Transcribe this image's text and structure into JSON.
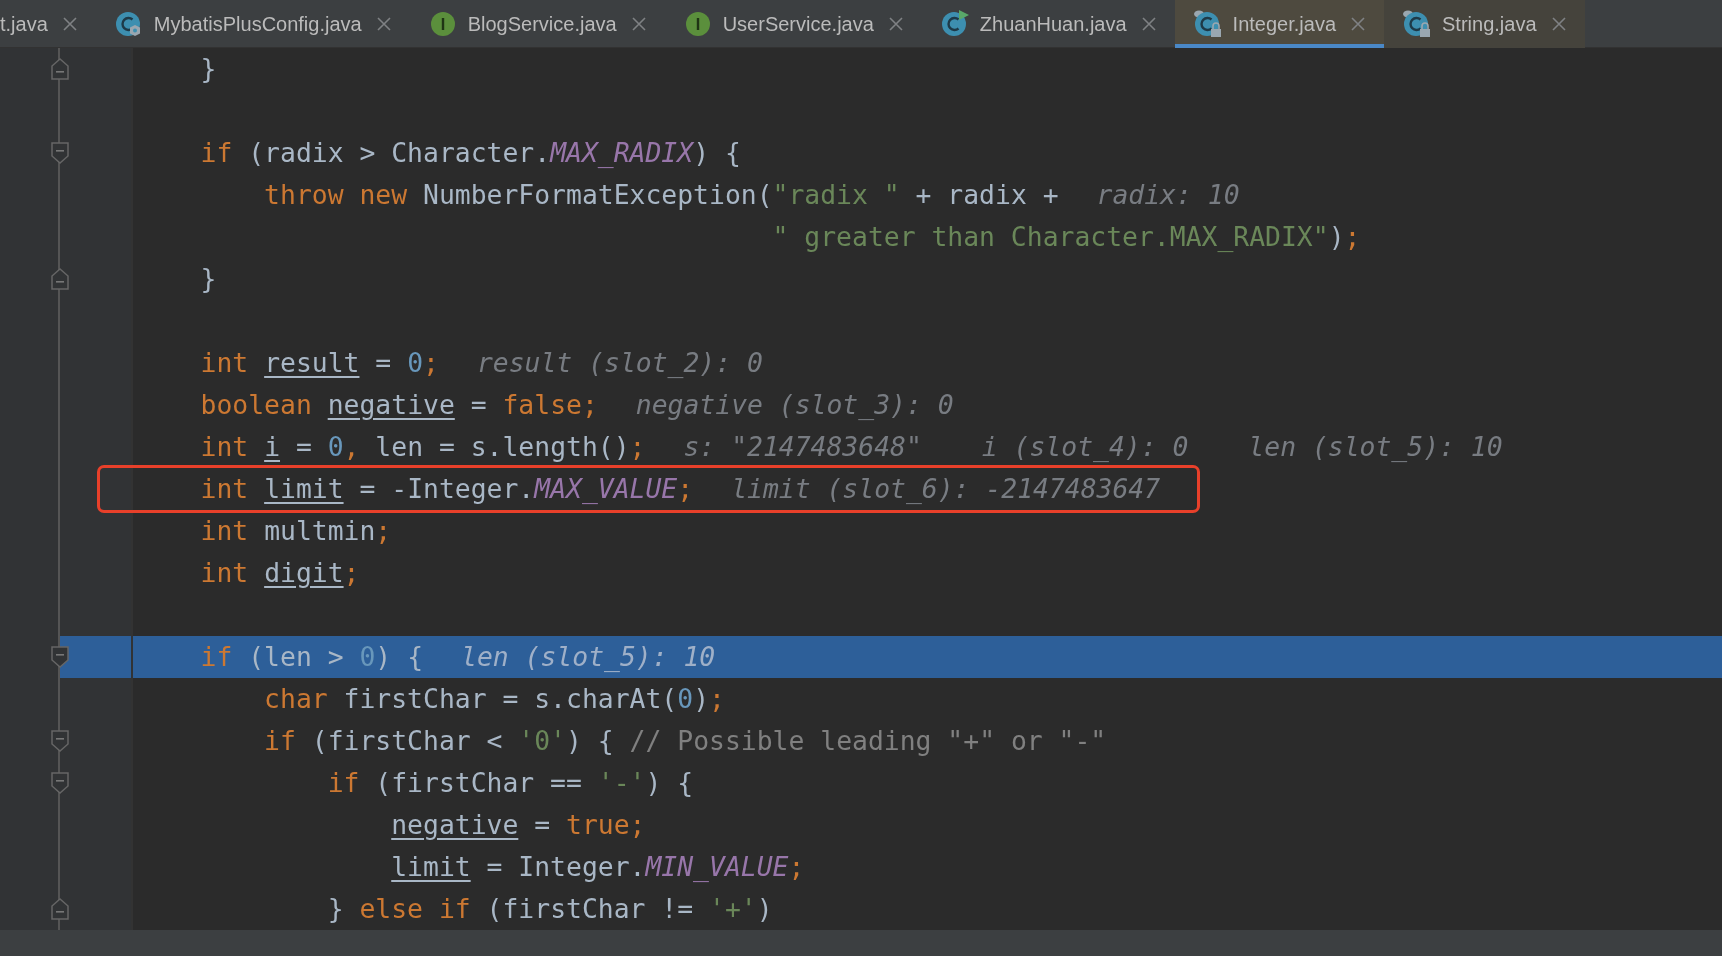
{
  "tabs": [
    {
      "label": "t.java",
      "selected": false,
      "library": false
    },
    {
      "label": "MybatisPlusConfig.java",
      "kind": "class-config",
      "selected": false,
      "library": false
    },
    {
      "label": "BlogService.java",
      "kind": "interface",
      "selected": false,
      "library": false
    },
    {
      "label": "UserService.java",
      "kind": "interface",
      "selected": false,
      "library": false
    },
    {
      "label": "ZhuanHuan.java",
      "kind": "class-runnable",
      "selected": false,
      "library": false
    },
    {
      "label": "Integer.java",
      "kind": "class-locked",
      "selected": true,
      "library": true
    },
    {
      "label": "String.java",
      "kind": "class-locked",
      "selected": false,
      "library": true
    }
  ],
  "lines": [
    {
      "kind": "fold-end",
      "selected": false,
      "boxed": false,
      "tokens": [
        {
          "text": "    }",
          "kind": "plain"
        }
      ]
    },
    {
      "kind": "blank",
      "selected": false,
      "boxed": false
    },
    {
      "kind": "fold-start",
      "selected": false,
      "boxed": false,
      "tokens": [
        {
          "text": "    if",
          "kind": "keyword"
        },
        {
          "text": " (radix > Character.",
          "kind": "plain"
        },
        {
          "text": "MAX_RADIX",
          "kind": "constant"
        },
        {
          "text": ") {",
          "kind": "plain"
        }
      ]
    },
    {
      "kind": "plain",
      "selected": false,
      "boxed": false,
      "tokens": [
        {
          "text": "        throw new",
          "kind": "keyword"
        },
        {
          "text": " NumberFormatException(",
          "kind": "plain"
        },
        {
          "text": "\"radix \"",
          "kind": "string"
        },
        {
          "text": " + radix +",
          "kind": "plain"
        }
      ],
      "hints": [
        "radix: 10"
      ]
    },
    {
      "kind": "plain",
      "selected": false,
      "boxed": false,
      "tokens": [
        {
          "text": "                                        \" greater than Character.MAX_RADIX\"",
          "kind": "string"
        },
        {
          "text": ")",
          "kind": "plain"
        },
        {
          "text": ";",
          "kind": "punct"
        }
      ]
    },
    {
      "kind": "fold-end",
      "selected": false,
      "boxed": false,
      "tokens": [
        {
          "text": "    }",
          "kind": "plain"
        }
      ]
    },
    {
      "kind": "blank",
      "selected": false,
      "boxed": false
    },
    {
      "kind": "plain",
      "selected": false,
      "boxed": false,
      "tokens": [
        {
          "text": "    int",
          "kind": "keyword"
        },
        {
          "text": " result",
          "kind": "local"
        },
        {
          "text": " = ",
          "kind": "plain"
        },
        {
          "text": "0",
          "kind": "number"
        },
        {
          "text": ";",
          "kind": "punct"
        }
      ],
      "hints": [
        "result (slot_2): 0"
      ]
    },
    {
      "kind": "plain",
      "selected": false,
      "boxed": false,
      "tokens": [
        {
          "text": "    boolean",
          "kind": "keyword"
        },
        {
          "text": " negative",
          "kind": "local"
        },
        {
          "text": " = ",
          "kind": "plain"
        },
        {
          "text": "false",
          "kind": "keyword"
        },
        {
          "text": ";",
          "kind": "punct"
        }
      ],
      "hints": [
        "negative (slot_3): 0"
      ]
    },
    {
      "kind": "plain",
      "selected": false,
      "boxed": false,
      "tokens": [
        {
          "text": "    int",
          "kind": "keyword"
        },
        {
          "text": " i",
          "kind": "local"
        },
        {
          "text": " = ",
          "kind": "plain"
        },
        {
          "text": "0",
          "kind": "number"
        },
        {
          "text": ",",
          "kind": "punct"
        },
        {
          "text": " len = s.length()",
          "kind": "plain"
        },
        {
          "text": ";",
          "kind": "punct"
        }
      ],
      "hints": [
        "s: \"2147483648\"",
        "i (slot_4): 0",
        "len (slot_5): 10"
      ]
    },
    {
      "kind": "plain",
      "selected": false,
      "boxed": true,
      "tokens": [
        {
          "text": "    int",
          "kind": "keyword"
        },
        {
          "text": " limit",
          "kind": "local"
        },
        {
          "text": " = -Integer.",
          "kind": "plain"
        },
        {
          "text": "MAX_VALUE",
          "kind": "constant"
        },
        {
          "text": ";",
          "kind": "punct"
        }
      ],
      "hints": [
        "limit (slot_6): -2147483647"
      ]
    },
    {
      "kind": "plain",
      "selected": false,
      "boxed": false,
      "tokens": [
        {
          "text": "    int",
          "kind": "keyword"
        },
        {
          "text": " multmin",
          "kind": "plain"
        },
        {
          "text": ";",
          "kind": "punct"
        }
      ]
    },
    {
      "kind": "plain",
      "selected": false,
      "boxed": false,
      "tokens": [
        {
          "text": "    int",
          "kind": "keyword"
        },
        {
          "text": " digit",
          "kind": "local"
        },
        {
          "text": ";",
          "kind": "punct"
        }
      ]
    },
    {
      "kind": "blank",
      "selected": false,
      "boxed": false
    },
    {
      "kind": "fold-start",
      "selected": true,
      "boxed": false,
      "tokens": [
        {
          "text": "    if",
          "kind": "keyword"
        },
        {
          "text": " (len > ",
          "kind": "plain"
        },
        {
          "text": "0",
          "kind": "number"
        },
        {
          "text": ") {",
          "kind": "plain"
        }
      ],
      "hints": [
        "len (slot_5): 10"
      ]
    },
    {
      "kind": "plain",
      "selected": false,
      "boxed": false,
      "tokens": [
        {
          "text": "        char",
          "kind": "keyword"
        },
        {
          "text": " firstChar = s.charAt(",
          "kind": "plain"
        },
        {
          "text": "0",
          "kind": "number"
        },
        {
          "text": ")",
          "kind": "plain"
        },
        {
          "text": ";",
          "kind": "punct"
        }
      ]
    },
    {
      "kind": "fold-start",
      "selected": false,
      "boxed": false,
      "tokens": [
        {
          "text": "        if",
          "kind": "keyword"
        },
        {
          "text": " (firstChar < ",
          "kind": "plain"
        },
        {
          "text": "'0'",
          "kind": "string"
        },
        {
          "text": ") { ",
          "kind": "plain"
        },
        {
          "text": "// Possible leading \"+\" or \"-\"",
          "kind": "comment"
        }
      ]
    },
    {
      "kind": "fold-start",
      "selected": false,
      "boxed": false,
      "tokens": [
        {
          "text": "            if",
          "kind": "keyword"
        },
        {
          "text": " (firstChar == ",
          "kind": "plain"
        },
        {
          "text": "'-'",
          "kind": "string"
        },
        {
          "text": ") {",
          "kind": "plain"
        }
      ]
    },
    {
      "kind": "plain",
      "selected": false,
      "boxed": false,
      "tokens": [
        {
          "text": "                negative",
          "kind": "local"
        },
        {
          "text": " = ",
          "kind": "plain"
        },
        {
          "text": "true",
          "kind": "keyword"
        },
        {
          "text": ";",
          "kind": "punct"
        }
      ]
    },
    {
      "kind": "plain",
      "selected": false,
      "boxed": false,
      "tokens": [
        {
          "text": "                limit",
          "kind": "local"
        },
        {
          "text": " = Integer.",
          "kind": "plain"
        },
        {
          "text": "MIN_VALUE",
          "kind": "constant"
        },
        {
          "text": ";",
          "kind": "punct"
        }
      ]
    },
    {
      "kind": "fold-end",
      "selected": false,
      "boxed": false,
      "tokens": [
        {
          "text": "            } ",
          "kind": "plain"
        },
        {
          "text": "else if",
          "kind": "keyword"
        },
        {
          "text": " (firstChar != ",
          "kind": "plain"
        },
        {
          "text": "'+'",
          "kind": "string"
        },
        {
          "text": ")",
          "kind": "plain"
        }
      ]
    }
  ]
}
